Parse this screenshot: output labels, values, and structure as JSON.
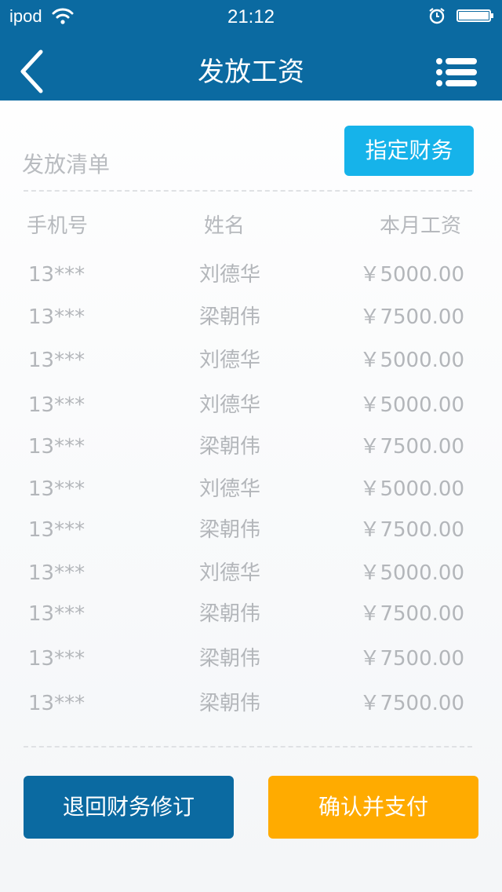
{
  "status_bar": {
    "carrier": "ipod",
    "time": "21:12"
  },
  "header": {
    "title": "发放工资",
    "back_icon": "chevron-left-icon",
    "menu_icon": "list-menu-icon",
    "background": "#0b6aa1"
  },
  "list": {
    "section_title": "发放清单",
    "assign_button": "指定财务",
    "columns": {
      "phone": "手机号",
      "name": "姓名",
      "salary": "本月工资"
    },
    "rows": [
      {
        "phone": "13***",
        "name": "刘德华",
        "salary": "￥5000.00"
      },
      {
        "phone": "13***",
        "name": "梁朝伟",
        "salary": "￥7500.00"
      },
      {
        "phone": "13***",
        "name": "刘德华",
        "salary": "￥5000.00"
      },
      {
        "phone": "13***",
        "name": "刘德华",
        "salary": "￥5000.00"
      },
      {
        "phone": "13***",
        "name": "梁朝伟",
        "salary": "￥7500.00"
      },
      {
        "phone": "13***",
        "name": "刘德华",
        "salary": "￥5000.00"
      },
      {
        "phone": "13***",
        "name": "梁朝伟",
        "salary": "￥7500.00"
      },
      {
        "phone": "13***",
        "name": "刘德华",
        "salary": "￥5000.00"
      },
      {
        "phone": "13***",
        "name": "梁朝伟",
        "salary": "￥7500.00"
      },
      {
        "phone": "13***",
        "name": "梁朝伟",
        "salary": "￥7500.00"
      },
      {
        "phone": "13***",
        "name": "梁朝伟",
        "salary": "￥7500.00"
      }
    ]
  },
  "actions": {
    "return_label": "退回财务修订",
    "confirm_label": "确认并支付",
    "return_color": "#0b6aa1",
    "confirm_color": "#ffab00"
  }
}
